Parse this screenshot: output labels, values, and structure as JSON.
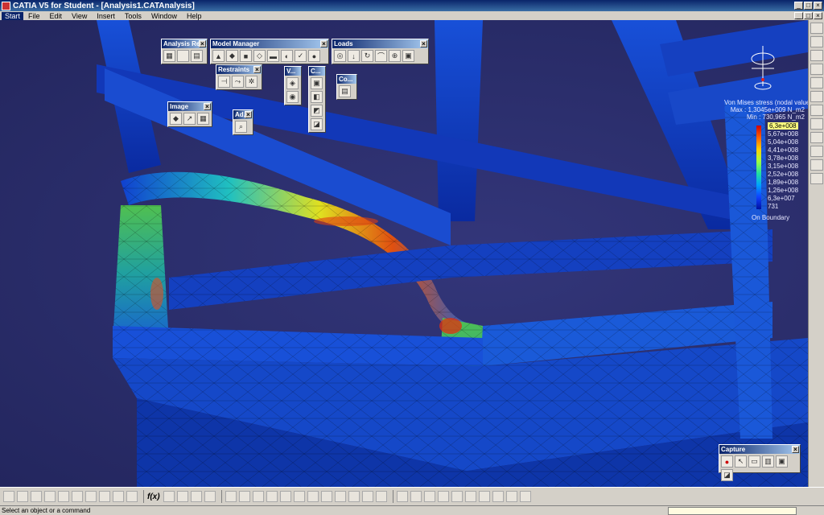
{
  "window": {
    "title": "CATIA V5 for Student - [Analysis1.CATAnalysis]"
  },
  "menu": {
    "items": [
      "Start",
      "File",
      "Edit",
      "View",
      "Insert",
      "Tools",
      "Window",
      "Help"
    ]
  },
  "toolbars": {
    "analysis_results": {
      "title": "Analysis Res..."
    },
    "model_manager": {
      "title": "Model Manager"
    },
    "loads": {
      "title": "Loads"
    },
    "restraints": {
      "title": "Restraints"
    },
    "v": {
      "title": "V..."
    },
    "c": {
      "title": "C..."
    },
    "co": {
      "title": "Co..."
    },
    "image": {
      "title": "Image"
    },
    "ad": {
      "title": "Ad..."
    },
    "capture": {
      "title": "Capture"
    }
  },
  "legend": {
    "title": "Von Mises stress (nodal values)",
    "max": "Max : 1,3045e+009 N_m2",
    "min": "Min : 730,965 N_m2",
    "values": [
      "6,3e+008",
      "5,67e+008",
      "5,04e+008",
      "4,41e+008",
      "3,78e+008",
      "3,15e+008",
      "2,52e+008",
      "1,89e+008",
      "1,26e+008",
      "6,3e+007",
      "731"
    ],
    "footer": "On Boundary"
  },
  "status": {
    "text": "Select an object or a command"
  },
  "icons": {
    "app": "catia-icon",
    "brand": "catia-logo"
  }
}
